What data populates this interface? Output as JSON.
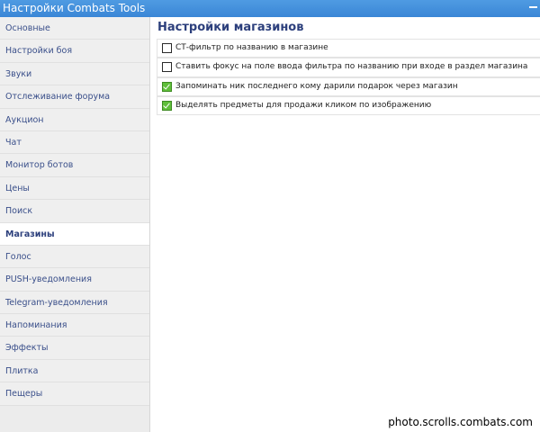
{
  "window": {
    "title": "Настройки Combats Tools",
    "close_icon": "minimize-icon"
  },
  "sidebar": {
    "items": [
      {
        "label": "Основные",
        "active": false
      },
      {
        "label": "Настройки боя",
        "active": false
      },
      {
        "label": "Звуки",
        "active": false
      },
      {
        "label": "Отслеживание форума",
        "active": false
      },
      {
        "label": "Аукцион",
        "active": false
      },
      {
        "label": "Чат",
        "active": false
      },
      {
        "label": "Монитор ботов",
        "active": false
      },
      {
        "label": "Цены",
        "active": false
      },
      {
        "label": "Поиск",
        "active": false
      },
      {
        "label": "Магазины",
        "active": true
      },
      {
        "label": "Голос",
        "active": false
      },
      {
        "label": "PUSH-уведомления",
        "active": false
      },
      {
        "label": "Telegram-уведомления",
        "active": false
      },
      {
        "label": "Напоминания",
        "active": false
      },
      {
        "label": "Эффекты",
        "active": false
      },
      {
        "label": "Плитка",
        "active": false
      },
      {
        "label": "Пещеры",
        "active": false
      }
    ]
  },
  "main": {
    "title": "Настройки магазинов",
    "options": [
      {
        "label": "СТ-фильтр по названию в магазине",
        "checked": false
      },
      {
        "label": "Ставить фокус на поле ввода фильтра по названию при входе в раздел магазина",
        "checked": false
      },
      {
        "label": "Запоминать ник последнего кому дарили подарок через магазин",
        "checked": true
      },
      {
        "label": "Выделять предметы для продажи кликом по изображению",
        "checked": true
      }
    ]
  },
  "watermark": "photo.scrolls.combats.com",
  "colors": {
    "titlebar": "#3f8ddc",
    "sidebar_bg": "#ececec",
    "nav_text": "#3a4f8a",
    "checkbox_checked": "#5fbf3a"
  }
}
